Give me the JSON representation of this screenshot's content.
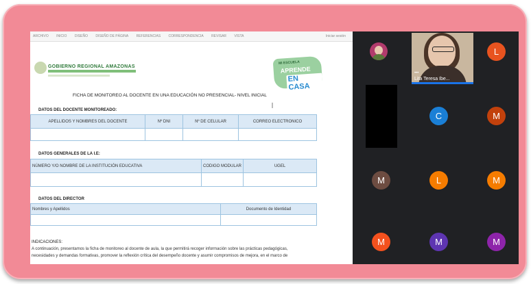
{
  "ribbon": {
    "tabs": [
      "ARCHIVO",
      "INICIO",
      "DISEÑO",
      "DISEÑO DE PÁGINA",
      "REFERENCIAS",
      "CORRESPONDENCIA",
      "REVISAR",
      "VISTA"
    ],
    "right_label": "Iniciar sesión"
  },
  "document": {
    "gov_header": "GOBIERNO REGIONAL AMAZONAS",
    "logo_text": {
      "line1": "MI ESCUELA",
      "line2": "APRENDE",
      "line3": "EN CASA"
    },
    "title": "FICHA DE MONITOREO AL DOCENTE EN UNA EDUCACIÓN NO PRESENCIAL- NIVEL INICIAL",
    "section1": {
      "heading": "DATOS DEL DOCENTE MONITOREADO:",
      "columns": [
        "APELLIDOS Y NOMBRES DEL DOCENTE",
        "Nº DNI",
        "Nº DE CELULAR",
        "CORREO ELECTRONICO"
      ]
    },
    "section2": {
      "heading": "DATOS GENERALES DE LA I.E:",
      "columns": [
        "NÚMERO Y/O NOMBRE DE LA INSTITUCIÓN EDUCATIVA",
        "CODIGO MODULAR",
        "UGEL"
      ]
    },
    "section3": {
      "heading": "DATOS DEL DIRECTOR",
      "columns": [
        "Nombres y Apellidos",
        "Documento de Identidad"
      ]
    },
    "indications": {
      "heading": "INDICACIONES:",
      "lines": [
        "A continuación, presentamos la ficha de monitoreo al docente de aula, la que permitirá recoger información sobre las prácticas pedagógicas,",
        "necesidades y demandas formativas, promover la reflexión crítica del desempeño docente y asumir compromisos de mejora, en el marco de"
      ]
    }
  },
  "meeting": {
    "presenter_name": "Lita Teresa Ibe...",
    "more_icon": "more-options-icon",
    "participants": [
      {
        "letter": "L",
        "color": "#e8531f"
      },
      {
        "letter": "C",
        "color": "#1a7fd6"
      },
      {
        "letter": "M",
        "color": "#c2410c"
      },
      {
        "letter": "M",
        "color": "#6d4c41"
      },
      {
        "letter": "L",
        "color": "#f57c00"
      },
      {
        "letter": "M",
        "color": "#f57c00"
      },
      {
        "letter": "M",
        "color": "#f4511e"
      },
      {
        "letter": "M",
        "color": "#5e35b1"
      },
      {
        "letter": "M",
        "color": "#8e24aa"
      }
    ]
  }
}
